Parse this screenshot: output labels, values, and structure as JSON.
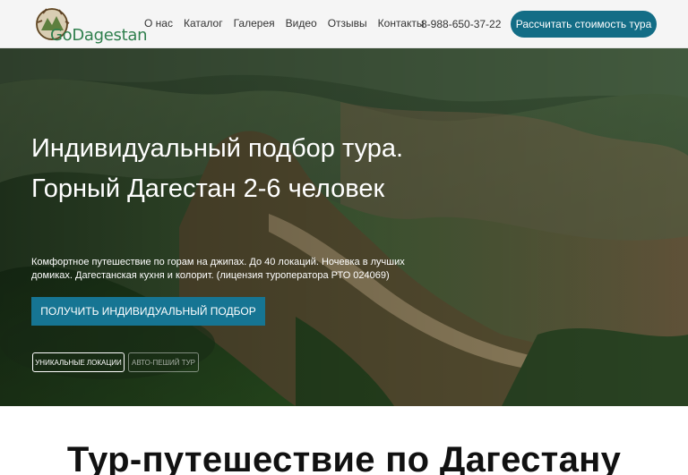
{
  "header": {
    "logo_text": "GoDagestan",
    "nav": [
      "О нас",
      "Каталог",
      "Галерея",
      "Видео",
      "Отзывы",
      "Контакты"
    ],
    "phone": "8-988-650-37-22",
    "cta_label": "Рассчитать стоимость тура"
  },
  "hero": {
    "title": "Индивидуальный подбор тура. Горный Дагестан 2-6 человек",
    "subtitle": "Комфортное путешествие по горам на джипах. До 40 локаций. Ночевка в лучших домиках. Дагестанская кухня и колорит. (лицензия туроператора РТО 024069)",
    "button_label": "ПОЛУЧИТЬ ИНДИВИДУАЛЬНЫЙ ПОДБОР",
    "tags": [
      "УНИКАЛЬНЫЕ ЛОКАЦИИ",
      "АВТО-ПЕШИЙ ТУР"
    ]
  },
  "section": {
    "title": "Тур-путешествие по Дагестану"
  },
  "colors": {
    "accent": "#136d86",
    "logo_green": "#2f7f4d",
    "header_bg": "#f5f5f5"
  },
  "icons": [
    "logo-emblem-icon"
  ]
}
